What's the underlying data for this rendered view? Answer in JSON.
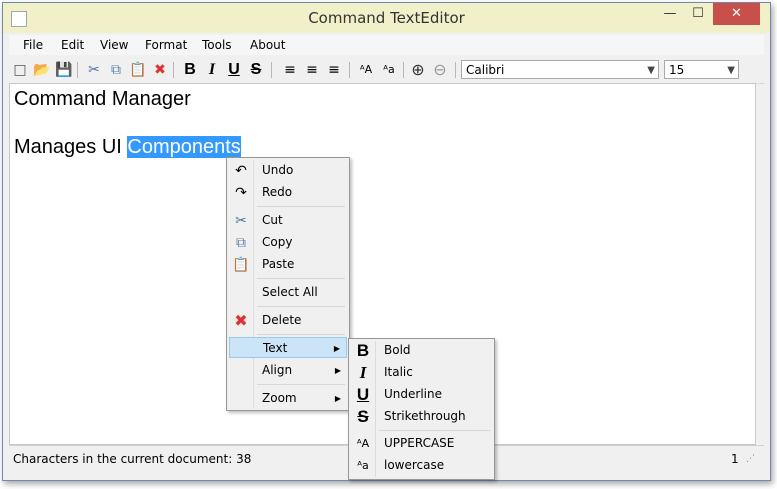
{
  "window": {
    "title": "Command TextEditor",
    "min_glyph": "—",
    "max_glyph": "☐",
    "close_glyph": "✕"
  },
  "menubar": [
    "File",
    "Edit",
    "View",
    "Format",
    "Tools",
    "About"
  ],
  "toolbar": {
    "font": "Calibri",
    "size": "15",
    "icons": {
      "new": "□",
      "open": "📂",
      "save": "💾",
      "cut": "✂",
      "copy": "⧉",
      "paste": "📋",
      "delete": "✖",
      "bold": "B",
      "italic": "I",
      "underline": "U",
      "strike": "S",
      "align_left": "≡",
      "align_center": "≡",
      "align_right": "≡",
      "upper": "ᴬA",
      "lower": "ᴬa",
      "zoom_in": "⊕",
      "zoom_out": "⊖"
    }
  },
  "editor": {
    "line1": "Command Manager",
    "line2_plain": "Manages UI ",
    "line2_selected": "Components"
  },
  "status": {
    "text": "Characters in the current document: 38",
    "number": "1"
  },
  "context_menu": {
    "items": [
      {
        "label": "Undo",
        "icon": "↶"
      },
      {
        "label": "Redo",
        "icon": "↷"
      },
      {
        "label": "Cut",
        "icon": "✂"
      },
      {
        "label": "Copy",
        "icon": "⧉"
      },
      {
        "label": "Paste",
        "icon": "📋"
      },
      {
        "label": "Select All",
        "icon": ""
      },
      {
        "label": "Delete",
        "icon": "✖"
      },
      {
        "label": "Text",
        "icon": ""
      },
      {
        "label": "Align",
        "icon": ""
      },
      {
        "label": "Zoom",
        "icon": ""
      }
    ]
  },
  "submenu": {
    "items": [
      {
        "label": "Bold",
        "icon": "B"
      },
      {
        "label": "Italic",
        "icon": "I"
      },
      {
        "label": "Underline",
        "icon": "U"
      },
      {
        "label": "Strikethrough",
        "icon": "S"
      },
      {
        "label": "UPPERCASE",
        "icon": "ᴬA"
      },
      {
        "label": "lowercase",
        "icon": "ᴬa"
      }
    ]
  },
  "colors": {
    "selection": "#3399ff",
    "titlebar": "#f2f0c8",
    "close": "#c7504a",
    "delete_icon": "#e03030",
    "highlight": "#cce4f7"
  }
}
